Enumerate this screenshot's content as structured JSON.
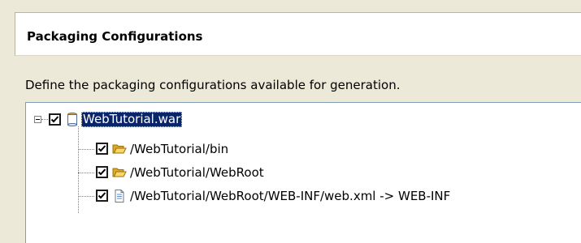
{
  "header": {
    "title": "Packaging Configurations"
  },
  "description": "Define the packaging configurations available for generation.",
  "tree": {
    "root": {
      "label": "WebTutorial.war",
      "checked": true,
      "expanded": true,
      "selected": true,
      "icon": "war-archive-icon"
    },
    "children": [
      {
        "label": "/WebTutorial/bin",
        "checked": true,
        "icon": "folder-icon"
      },
      {
        "label": "/WebTutorial/WebRoot",
        "checked": true,
        "icon": "folder-icon"
      },
      {
        "label": "/WebTutorial/WebRoot/WEB-INF/web.xml -> WEB-INF",
        "checked": true,
        "icon": "file-icon"
      }
    ]
  },
  "colors": {
    "selection": "#0a246a",
    "folder": "#f5c842",
    "background": "#ece9d8"
  }
}
